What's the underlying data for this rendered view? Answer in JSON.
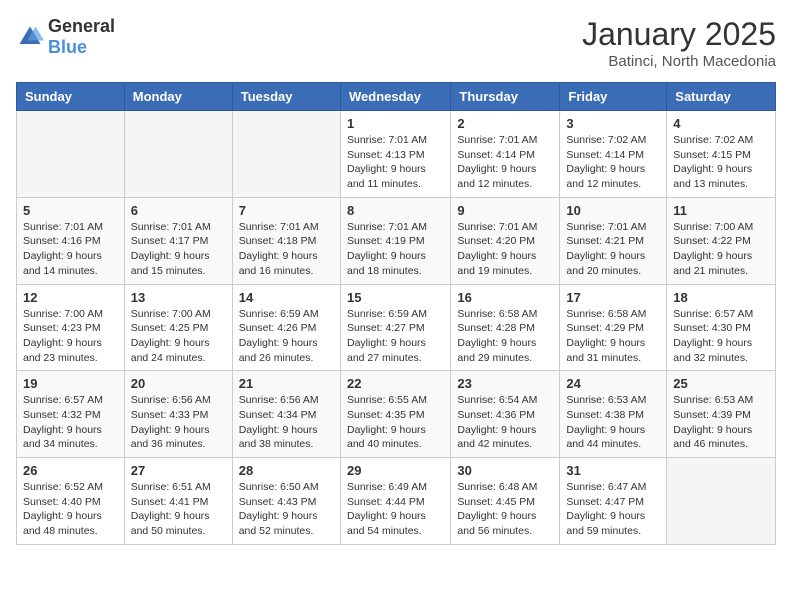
{
  "logo": {
    "general": "General",
    "blue": "Blue"
  },
  "header": {
    "title": "January 2025",
    "location": "Batinci, North Macedonia"
  },
  "days_of_week": [
    "Sunday",
    "Monday",
    "Tuesday",
    "Wednesday",
    "Thursday",
    "Friday",
    "Saturday"
  ],
  "weeks": [
    [
      {
        "day": "",
        "sunrise": "",
        "sunset": "",
        "daylight": ""
      },
      {
        "day": "",
        "sunrise": "",
        "sunset": "",
        "daylight": ""
      },
      {
        "day": "",
        "sunrise": "",
        "sunset": "",
        "daylight": ""
      },
      {
        "day": "1",
        "sunrise": "Sunrise: 7:01 AM",
        "sunset": "Sunset: 4:13 PM",
        "daylight": "Daylight: 9 hours and 11 minutes."
      },
      {
        "day": "2",
        "sunrise": "Sunrise: 7:01 AM",
        "sunset": "Sunset: 4:14 PM",
        "daylight": "Daylight: 9 hours and 12 minutes."
      },
      {
        "day": "3",
        "sunrise": "Sunrise: 7:02 AM",
        "sunset": "Sunset: 4:14 PM",
        "daylight": "Daylight: 9 hours and 12 minutes."
      },
      {
        "day": "4",
        "sunrise": "Sunrise: 7:02 AM",
        "sunset": "Sunset: 4:15 PM",
        "daylight": "Daylight: 9 hours and 13 minutes."
      }
    ],
    [
      {
        "day": "5",
        "sunrise": "Sunrise: 7:01 AM",
        "sunset": "Sunset: 4:16 PM",
        "daylight": "Daylight: 9 hours and 14 minutes."
      },
      {
        "day": "6",
        "sunrise": "Sunrise: 7:01 AM",
        "sunset": "Sunset: 4:17 PM",
        "daylight": "Daylight: 9 hours and 15 minutes."
      },
      {
        "day": "7",
        "sunrise": "Sunrise: 7:01 AM",
        "sunset": "Sunset: 4:18 PM",
        "daylight": "Daylight: 9 hours and 16 minutes."
      },
      {
        "day": "8",
        "sunrise": "Sunrise: 7:01 AM",
        "sunset": "Sunset: 4:19 PM",
        "daylight": "Daylight: 9 hours and 18 minutes."
      },
      {
        "day": "9",
        "sunrise": "Sunrise: 7:01 AM",
        "sunset": "Sunset: 4:20 PM",
        "daylight": "Daylight: 9 hours and 19 minutes."
      },
      {
        "day": "10",
        "sunrise": "Sunrise: 7:01 AM",
        "sunset": "Sunset: 4:21 PM",
        "daylight": "Daylight: 9 hours and 20 minutes."
      },
      {
        "day": "11",
        "sunrise": "Sunrise: 7:00 AM",
        "sunset": "Sunset: 4:22 PM",
        "daylight": "Daylight: 9 hours and 21 minutes."
      }
    ],
    [
      {
        "day": "12",
        "sunrise": "Sunrise: 7:00 AM",
        "sunset": "Sunset: 4:23 PM",
        "daylight": "Daylight: 9 hours and 23 minutes."
      },
      {
        "day": "13",
        "sunrise": "Sunrise: 7:00 AM",
        "sunset": "Sunset: 4:25 PM",
        "daylight": "Daylight: 9 hours and 24 minutes."
      },
      {
        "day": "14",
        "sunrise": "Sunrise: 6:59 AM",
        "sunset": "Sunset: 4:26 PM",
        "daylight": "Daylight: 9 hours and 26 minutes."
      },
      {
        "day": "15",
        "sunrise": "Sunrise: 6:59 AM",
        "sunset": "Sunset: 4:27 PM",
        "daylight": "Daylight: 9 hours and 27 minutes."
      },
      {
        "day": "16",
        "sunrise": "Sunrise: 6:58 AM",
        "sunset": "Sunset: 4:28 PM",
        "daylight": "Daylight: 9 hours and 29 minutes."
      },
      {
        "day": "17",
        "sunrise": "Sunrise: 6:58 AM",
        "sunset": "Sunset: 4:29 PM",
        "daylight": "Daylight: 9 hours and 31 minutes."
      },
      {
        "day": "18",
        "sunrise": "Sunrise: 6:57 AM",
        "sunset": "Sunset: 4:30 PM",
        "daylight": "Daylight: 9 hours and 32 minutes."
      }
    ],
    [
      {
        "day": "19",
        "sunrise": "Sunrise: 6:57 AM",
        "sunset": "Sunset: 4:32 PM",
        "daylight": "Daylight: 9 hours and 34 minutes."
      },
      {
        "day": "20",
        "sunrise": "Sunrise: 6:56 AM",
        "sunset": "Sunset: 4:33 PM",
        "daylight": "Daylight: 9 hours and 36 minutes."
      },
      {
        "day": "21",
        "sunrise": "Sunrise: 6:56 AM",
        "sunset": "Sunset: 4:34 PM",
        "daylight": "Daylight: 9 hours and 38 minutes."
      },
      {
        "day": "22",
        "sunrise": "Sunrise: 6:55 AM",
        "sunset": "Sunset: 4:35 PM",
        "daylight": "Daylight: 9 hours and 40 minutes."
      },
      {
        "day": "23",
        "sunrise": "Sunrise: 6:54 AM",
        "sunset": "Sunset: 4:36 PM",
        "daylight": "Daylight: 9 hours and 42 minutes."
      },
      {
        "day": "24",
        "sunrise": "Sunrise: 6:53 AM",
        "sunset": "Sunset: 4:38 PM",
        "daylight": "Daylight: 9 hours and 44 minutes."
      },
      {
        "day": "25",
        "sunrise": "Sunrise: 6:53 AM",
        "sunset": "Sunset: 4:39 PM",
        "daylight": "Daylight: 9 hours and 46 minutes."
      }
    ],
    [
      {
        "day": "26",
        "sunrise": "Sunrise: 6:52 AM",
        "sunset": "Sunset: 4:40 PM",
        "daylight": "Daylight: 9 hours and 48 minutes."
      },
      {
        "day": "27",
        "sunrise": "Sunrise: 6:51 AM",
        "sunset": "Sunset: 4:41 PM",
        "daylight": "Daylight: 9 hours and 50 minutes."
      },
      {
        "day": "28",
        "sunrise": "Sunrise: 6:50 AM",
        "sunset": "Sunset: 4:43 PM",
        "daylight": "Daylight: 9 hours and 52 minutes."
      },
      {
        "day": "29",
        "sunrise": "Sunrise: 6:49 AM",
        "sunset": "Sunset: 4:44 PM",
        "daylight": "Daylight: 9 hours and 54 minutes."
      },
      {
        "day": "30",
        "sunrise": "Sunrise: 6:48 AM",
        "sunset": "Sunset: 4:45 PM",
        "daylight": "Daylight: 9 hours and 56 minutes."
      },
      {
        "day": "31",
        "sunrise": "Sunrise: 6:47 AM",
        "sunset": "Sunset: 4:47 PM",
        "daylight": "Daylight: 9 hours and 59 minutes."
      },
      {
        "day": "",
        "sunrise": "",
        "sunset": "",
        "daylight": ""
      }
    ]
  ]
}
